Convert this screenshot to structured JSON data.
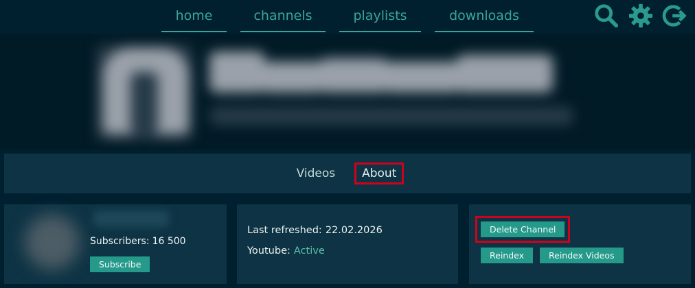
{
  "nav": {
    "links": [
      "home",
      "channels",
      "playlists",
      "downloads"
    ],
    "icons": [
      "search-icon",
      "gear-icon",
      "logout-icon"
    ]
  },
  "tabs": [
    {
      "label": "Videos",
      "active": false
    },
    {
      "label": "About",
      "active": true
    }
  ],
  "channel": {
    "subscribers_label": "Subscribers:",
    "subscribers_value": "16 500",
    "subscribe_button": "Subscribe"
  },
  "info": {
    "last_refreshed_label": "Last refreshed:",
    "last_refreshed_value": "22.02.2026",
    "youtube_label": "Youtube:",
    "youtube_value": "Active"
  },
  "actions": {
    "delete_channel": "Delete Channel",
    "reindex": "Reindex",
    "reindex_videos": "Reindex Videos"
  },
  "colors": {
    "background": "#00202f",
    "panel": "#0d3344",
    "accent": "#3aa69a",
    "button": "#259a8b",
    "highlight": "#d0021b"
  }
}
